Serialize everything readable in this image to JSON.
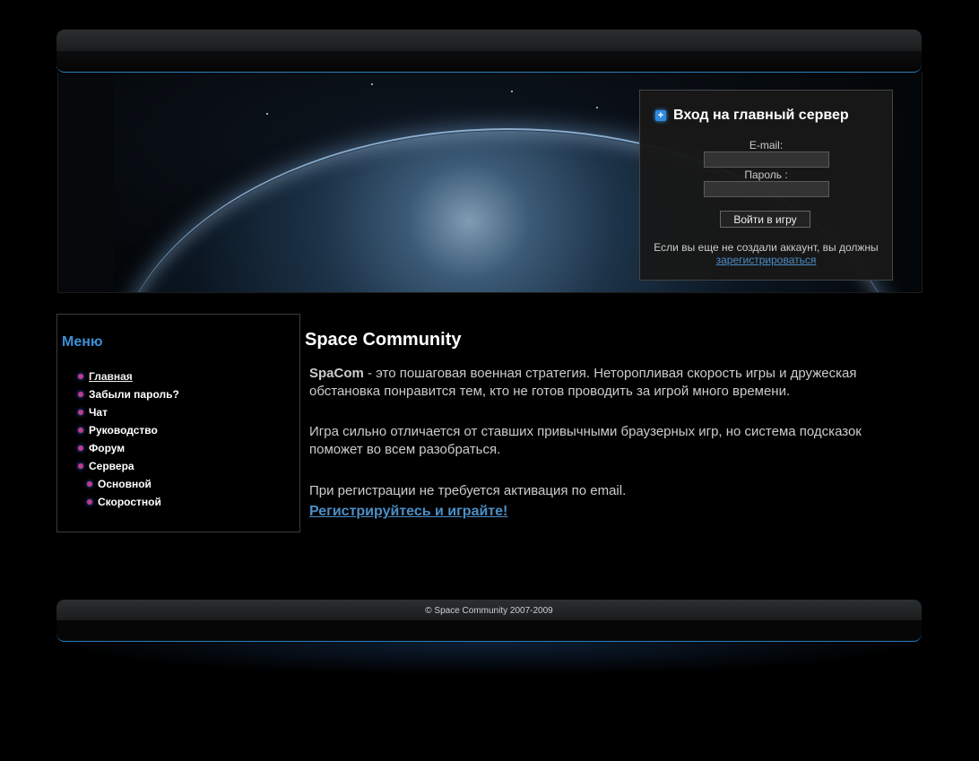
{
  "login": {
    "title": "Вход на главный сервер",
    "email_label": "E-mail:",
    "email_value": "",
    "password_label": "Пароль :",
    "password_value": "",
    "submit_label": "Войти в игру",
    "note_text": "Если вы еще не создали аккаунт, вы должны",
    "register_link": "зарегистрироваться"
  },
  "menu": {
    "title": "Меню",
    "items": [
      {
        "label": "Главная",
        "active": true
      },
      {
        "label": "Забыли пароль?"
      },
      {
        "label": "Чат"
      },
      {
        "label": "Руководство"
      },
      {
        "label": "Форум"
      },
      {
        "label": "Сервера"
      },
      {
        "label": "Основной",
        "sub": true
      },
      {
        "label": "Скоростной",
        "sub": true
      }
    ]
  },
  "main": {
    "title": "Space Community",
    "brand": "SpaCom",
    "paragraph1_rest": " - это пошаговая военная стратегия. Неторопливая скорость игры и дружеская обстановка понравится тем, кто не готов проводить за игрой много времени.",
    "paragraph2": "Игра сильно отличается от ставших привычными браузерных игр, но система подсказок поможет во всем разобраться.",
    "paragraph3": "При регистрации не требуется активация по email.",
    "cta": "Регистрируйтесь и играйте!"
  },
  "footer": {
    "copyright": "© Space Community 2007-2009"
  },
  "colors": {
    "accent_blue": "#3b8fd6",
    "link_blue": "#4c8ec6",
    "menu_bullet": "#c03a8a"
  }
}
